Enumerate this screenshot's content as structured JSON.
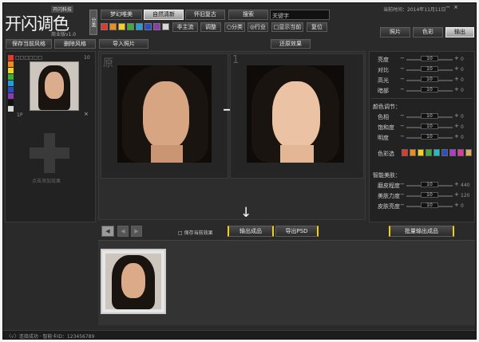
{
  "app": {
    "logo_text": "开闪调色",
    "logo_tag": "开闪科技",
    "edition": "商业版v1.0",
    "vertical_label": "分类",
    "status_date": "当前时间：2014年11月11日"
  },
  "top_tabs": [
    "梦幻唯美",
    "自然清新",
    "怀旧复古"
  ],
  "active_tab": 1,
  "search": {
    "button_label": "搜索",
    "keyword_label": "关键字"
  },
  "style_tags": [
    "非主流",
    "调整"
  ],
  "radio_options": [
    "分类",
    "行业"
  ],
  "only_current_label": "显示当前",
  "reset_label": "复位",
  "window_buttons": [
    "照片",
    "色彩",
    "输出"
  ],
  "swatch_colors": [
    "#e23a2a",
    "#f08b1f",
    "#f3d21f",
    "#3cae3a",
    "#1fa0d8",
    "#2a4fc0",
    "#8b3ab0",
    "#d8d8d8"
  ],
  "left_panel": {
    "save_button": "保存当前风格",
    "delete_button": "删除风格",
    "color_chips": [
      "#e23a2a",
      "#f08b1f",
      "#f3d21f",
      "#3cae3a",
      "#1fa0d8",
      "#2a4fc0",
      "#8b3ab0",
      "#111111",
      "#d8d8d8"
    ],
    "chip_row_text": "□□□□□□",
    "item_count": "10",
    "item_label": "1P",
    "add_label": "点击添加效果"
  },
  "center": {
    "import_button": "导入照片",
    "restore_button": "还原效果",
    "original_label": "原",
    "result_label": "1",
    "arrow_right": "→",
    "arrow_down": "↓"
  },
  "right_panel": {
    "sliders_a": [
      {
        "label": "亮度",
        "value": "10",
        "display": "0"
      },
      {
        "label": "对比",
        "value": "10",
        "display": "0"
      },
      {
        "label": "高光",
        "value": "10",
        "display": "0"
      },
      {
        "label": "暗部",
        "value": "10",
        "display": "0"
      }
    ],
    "color_section_title": "颜色调节：",
    "sliders_b": [
      {
        "label": "色相",
        "value": "10",
        "display": "0"
      },
      {
        "label": "饱和度",
        "value": "10",
        "display": "0"
      },
      {
        "label": "明度",
        "value": "10",
        "display": "0"
      }
    ],
    "picker_label": "色彩选",
    "picker_colors": [
      "#e23a2a",
      "#f08b1f",
      "#f3d21f",
      "#3cae3a",
      "#1fc0c0",
      "#2a4fc0",
      "#b33ad0",
      "#e03aa0",
      "#d8b060"
    ],
    "smart_section_title": "智能美肤：",
    "sliders_c": [
      {
        "label": "磨皮程度",
        "value": "10",
        "display": "440"
      },
      {
        "label": "美肤力度",
        "value": "10",
        "display": "120"
      },
      {
        "label": "皮肤亮度",
        "value": "10",
        "display": "0"
      }
    ]
  },
  "bottom_toolbar": {
    "prev_label": "◀",
    "next_label": "▶",
    "thumb_toggle": "□ 保存当前效果",
    "export_button": "输出成品",
    "psd_button": "导出PSD",
    "batch_button": "批量输出成品"
  },
  "status_bar": {
    "text": "〈√〉连接成功 · 智能卡ID：123456789"
  }
}
